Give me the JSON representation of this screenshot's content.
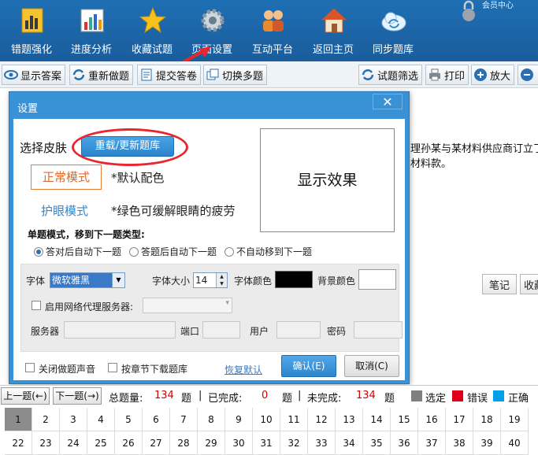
{
  "topnav": {
    "items": [
      {
        "label": "错题强化",
        "icon": "chart-book-icon"
      },
      {
        "label": "进度分析",
        "icon": "bar-chart-icon"
      },
      {
        "label": "收藏试题",
        "icon": "star-icon"
      },
      {
        "label": "页面设置",
        "icon": "gear-icon"
      },
      {
        "label": "互动平台",
        "icon": "people-icon"
      },
      {
        "label": "返回主页",
        "icon": "home-icon"
      },
      {
        "label": "同步题库",
        "icon": "cloud-sync-icon"
      }
    ],
    "member_link": "会员中心"
  },
  "toolbar": {
    "show_answer": "显示答案",
    "redo": "重新做题",
    "submit": "提交答卷",
    "switch_multi": "切换多题",
    "filter": "试题筛选",
    "print": "打印",
    "zoom_in": "放大"
  },
  "background": {
    "line1_fragment": "理孙某与某材料供应商订立了",
    "line2_fragment": "材料款。",
    "note_button": "笔记",
    "collect_button": "收藏"
  },
  "dialog": {
    "title": "设置",
    "close": "✕",
    "skin_label": "选择皮肤",
    "reload_button": "重载/更新题库",
    "mode_normal": "正常模式",
    "mode_normal_desc": "*默认配色",
    "mode_eye": "护眼模式",
    "mode_eye_desc": "*绿色可缓解眼睛的疲劳",
    "preview": "显示效果",
    "single_mode_heading": "单题模式，移到下一题类型:",
    "radio_options": [
      "答对后自动下一题",
      "答题后自动下一题",
      "不自动移到下一题"
    ],
    "font_label": "字体",
    "font_value": "微软雅黑",
    "font_size_label": "字体大小",
    "font_size_value": "14",
    "font_color_label": "字体颜色",
    "bg_color_label": "背景颜色",
    "proxy_label": "启用网络代理服务器:",
    "server_label": "服务器",
    "port_label": "端口",
    "user_label": "用户",
    "password_label": "密码",
    "mute_label": "关闭做题声音",
    "chapter_download_label": "按章节下载题库",
    "restore_default": "恢复默认",
    "ok": "确认(E)",
    "cancel": "取消(C)"
  },
  "status": {
    "prev": "上一题(←)",
    "next": "下一题(→)",
    "total_label": "总题量:",
    "total_value": "134",
    "unit": "题",
    "done_label": "已完成:",
    "done_value": "0",
    "undone_label": "未完成:",
    "undone_value": "134",
    "legend_selected": "选定",
    "legend_wrong": "错误",
    "legend_correct": "正确",
    "colors": {
      "selected": "#7f7f7f",
      "wrong": "#e0001b",
      "correct": "#00a0e9"
    }
  },
  "question_numbers": [
    "1",
    "2",
    "3",
    "4",
    "5",
    "6",
    "7",
    "8",
    "9",
    "10",
    "11",
    "12",
    "13",
    "14",
    "15",
    "16",
    "17",
    "18",
    "19",
    "22",
    "23",
    "24",
    "25",
    "26",
    "27",
    "28",
    "29",
    "30",
    "31",
    "32",
    "33",
    "34",
    "35",
    "36",
    "37",
    "38",
    "39",
    "40"
  ]
}
